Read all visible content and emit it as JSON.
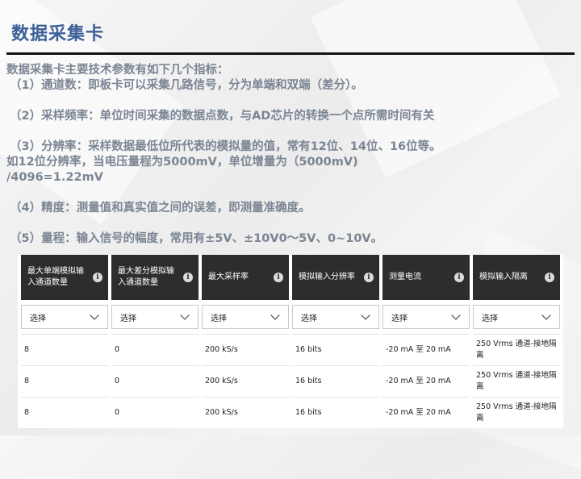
{
  "slide": {
    "title": "数据采集卡",
    "intro": "数据采集卡主要技术参数有如下几个指标：",
    "items": [
      "（1）通道数：即板卡可以采集几路信号，分为单端和双端（差分）。",
      "（2）采样频率：单位时间采集的数据点数，与AD芯片的转换一个点所需时间有关",
      "（3）分辨率：采样数据最低位所代表的模拟量的值，常有12位、14位、16位等。",
      "如12位分辨率，当电压量程为5000mV，单位增量为（5000mV)",
      "/4096=1.22mV",
      "（4）精度：测量值和真实值之间的误差，即测量准确度。",
      "（5）量程：输入信号的幅度，常用有±5V、±10V0～5V、0~10V。"
    ]
  },
  "table": {
    "headers": [
      "最大单端模拟输入通道数量",
      "最大差分模拟输入通道数量",
      "最大采样率",
      "模拟输入分辨率",
      "测量电流",
      "模拟输入隔离"
    ],
    "info_icon": "i",
    "select_label": "选择",
    "rows": [
      [
        "8",
        "0",
        "200 kS/s",
        "16 bits",
        "-20 mA 至 20 mA",
        "250 Vrms 通道-接地隔离"
      ],
      [
        "8",
        "0",
        "200 kS/s",
        "16 bits",
        "-20 mA 至 20 mA",
        "250 Vrms 通道-接地隔离"
      ],
      [
        "8",
        "0",
        "200 kS/s",
        "16 bits",
        "-20 mA 至 20 mA",
        "250 Vrms 通道-接地隔离"
      ]
    ]
  },
  "colors": {
    "title": "#3b5f97",
    "body_text": "#7b8593",
    "header_bg": "#2d2d2d"
  },
  "icons": {
    "info": "info-circle-icon",
    "dropdown": "chevron-down-icon"
  }
}
